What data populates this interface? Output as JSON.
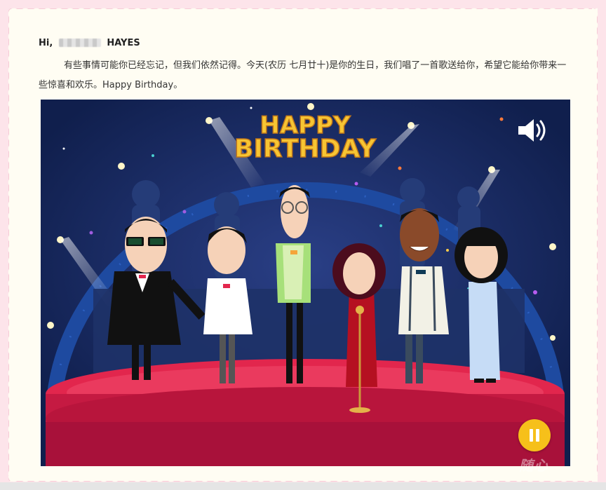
{
  "email": {
    "greeting_prefix": "Hi,",
    "greeting_name": "HAYES",
    "message": "有些事情可能你已经忘记，但我们依然记得。今天(农历 七月廿十)是你的生日，我们唱了一首歌送给你，希望它能给你带来一些惊喜和欢乐。Happy Birthday。"
  },
  "video": {
    "title_line1": "HAPPY",
    "title_line2": "BIRTHDAY",
    "speaker_icon": "speaker-volume-icon",
    "pause_icon": "pause-icon",
    "watermark": "随心"
  },
  "colors": {
    "stage_bg": "#13265a",
    "stage_floor": "#e2264d",
    "title_gold": "#f7c533",
    "pause_button": "#f6c01a"
  }
}
